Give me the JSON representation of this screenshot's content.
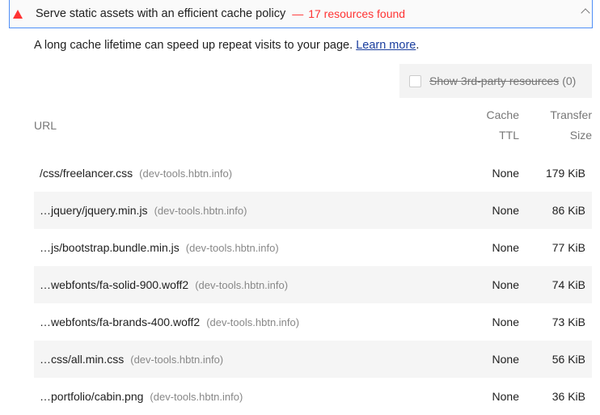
{
  "audit": {
    "title": "Serve static assets with an efficient cache policy",
    "separator": "—",
    "summary": "17 resources found",
    "severity_color": "#ff3333",
    "status_icon": "warning-triangle-icon",
    "expanded": true
  },
  "description": {
    "text": "A long cache lifetime can speed up repeat visits to your page. ",
    "link": "Learn more",
    "period": "."
  },
  "filter": {
    "label": "Show 3rd-party resources",
    "count": "(0)",
    "checked": false
  },
  "table": {
    "headers": {
      "url": "URL",
      "ttl_1": "Cache",
      "ttl_2": "TTL",
      "size_1": "Transfer",
      "size_2": "Size"
    },
    "rows": [
      {
        "url": "/css/freelancer.css",
        "host": "(dev-tools.hbtn.info)",
        "ttl": "None",
        "size": "179 KiB"
      },
      {
        "url": "…jquery/jquery.min.js",
        "host": "(dev-tools.hbtn.info)",
        "ttl": "None",
        "size": "86 KiB"
      },
      {
        "url": "…js/bootstrap.bundle.min.js",
        "host": "(dev-tools.hbtn.info)",
        "ttl": "None",
        "size": "77 KiB"
      },
      {
        "url": "…webfonts/fa-solid-900.woff2",
        "host": "(dev-tools.hbtn.info)",
        "ttl": "None",
        "size": "74 KiB"
      },
      {
        "url": "…webfonts/fa-brands-400.woff2",
        "host": "(dev-tools.hbtn.info)",
        "ttl": "None",
        "size": "73 KiB"
      },
      {
        "url": "…css/all.min.css",
        "host": "(dev-tools.hbtn.info)",
        "ttl": "None",
        "size": "56 KiB"
      },
      {
        "url": "…portfolio/cabin.png",
        "host": "(dev-tools.hbtn.info)",
        "ttl": "None",
        "size": "36 KiB"
      }
    ]
  }
}
